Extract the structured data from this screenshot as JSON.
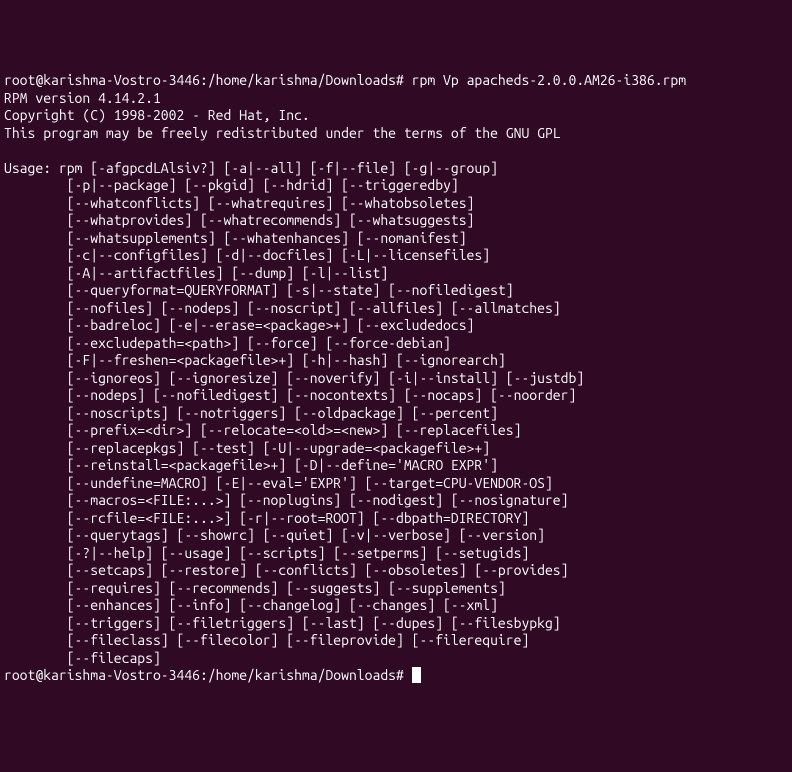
{
  "prompt1": {
    "user": "root@karishma-Vostro-3446",
    "path": ":/home/karishma/Downloads#",
    "command": " rpm Vp apacheds-2.0.0.AM26-i386.rpm"
  },
  "header": {
    "version": "RPM version 4.14.2.1",
    "copyright": "Copyright (C) 1998-2002 - Red Hat, Inc.",
    "license": "This program may be freely redistributed under the terms of the GNU GPL"
  },
  "usage": {
    "line0": "Usage: rpm [-afgpcdLAlsiv?] [-a|--all] [-f|--file] [-g|--group]",
    "line1": "        [-p|--package] [--pkgid] [--hdrid] [--triggeredby]",
    "line2": "        [--whatconflicts] [--whatrequires] [--whatobsoletes]",
    "line3": "        [--whatprovides] [--whatrecommends] [--whatsuggests]",
    "line4": "        [--whatsupplements] [--whatenhances] [--nomanifest]",
    "line5": "        [-c|--configfiles] [-d|--docfiles] [-L|--licensefiles]",
    "line6": "        [-A|--artifactfiles] [--dump] [-l|--list]",
    "line7": "        [--queryformat=QUERYFORMAT] [-s|--state] [--nofiledigest]",
    "line8": "        [--nofiles] [--nodeps] [--noscript] [--allfiles] [--allmatches]",
    "line9": "        [--badreloc] [-e|--erase=<package>+] [--excludedocs]",
    "line10": "        [--excludepath=<path>] [--force] [--force-debian]",
    "line11": "        [-F|--freshen=<packagefile>+] [-h|--hash] [--ignorearch]",
    "line12": "        [--ignoreos] [--ignoresize] [--noverify] [-i|--install] [--justdb]",
    "line13": "        [--nodeps] [--nofiledigest] [--nocontexts] [--nocaps] [--noorder]",
    "line14": "        [--noscripts] [--notriggers] [--oldpackage] [--percent]",
    "line15": "        [--prefix=<dir>] [--relocate=<old>=<new>] [--replacefiles]",
    "line16": "        [--replacepkgs] [--test] [-U|--upgrade=<packagefile>+]",
    "line17": "        [--reinstall=<packagefile>+] [-D|--define='MACRO EXPR']",
    "line18": "        [--undefine=MACRO] [-E|--eval='EXPR'] [--target=CPU-VENDOR-OS]",
    "line19": "        [--macros=<FILE:...>] [--noplugins] [--nodigest] [--nosignature]",
    "line20": "        [--rcfile=<FILE:...>] [-r|--root=ROOT] [--dbpath=DIRECTORY]",
    "line21": "        [--querytags] [--showrc] [--quiet] [-v|--verbose] [--version]",
    "line22": "        [-?|--help] [--usage] [--scripts] [--setperms] [--setugids]",
    "line23": "        [--setcaps] [--restore] [--conflicts] [--obsoletes] [--provides]",
    "line24": "        [--requires] [--recommends] [--suggests] [--supplements]",
    "line25": "        [--enhances] [--info] [--changelog] [--changes] [--xml]",
    "line26": "        [--triggers] [--filetriggers] [--last] [--dupes] [--filesbypkg]",
    "line27": "        [--fileclass] [--filecolor] [--fileprovide] [--filerequire]",
    "line28": "        [--filecaps]"
  },
  "prompt2": {
    "user": "root@karishma-Vostro-3446",
    "path": ":/home/karishma/Downloads#",
    "command": " "
  }
}
